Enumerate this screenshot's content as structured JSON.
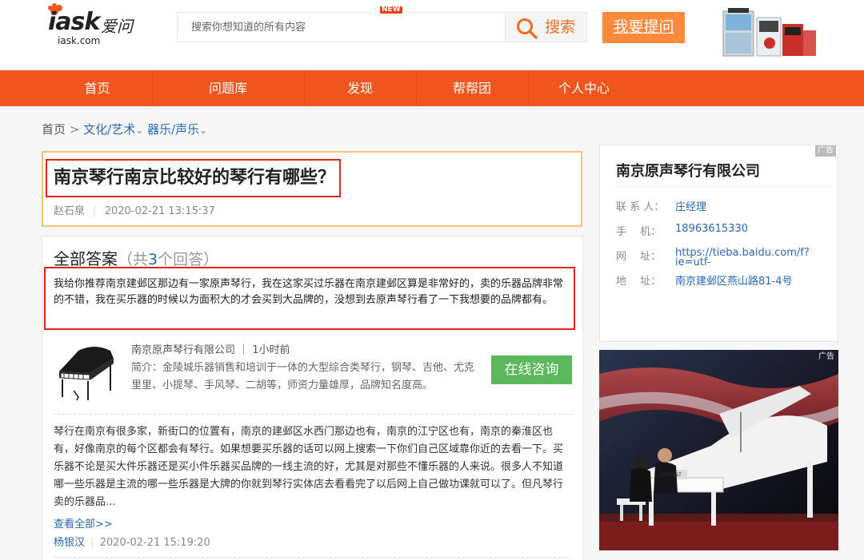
{
  "header": {
    "logo_text": "iask",
    "logo_cn": "爱问",
    "logo_domain": "iask.com",
    "search_placeholder": "搜索你想知道的所有内容",
    "search_button": "搜索",
    "ask_button": "我要提问"
  },
  "nav": {
    "items": [
      "首页",
      "问题库",
      "发现",
      "帮帮团",
      "个人中心"
    ],
    "new_badge": "NEW"
  },
  "breadcrumb": {
    "home": "首页",
    "sep": ">",
    "cat1": "文化/艺术",
    "cat2": "器乐/声乐"
  },
  "question": {
    "title": "南京琴行南京比较好的琴行有哪些？",
    "author": "赵石泉",
    "datetime": "2020-02-21 13:15:37"
  },
  "answers": {
    "heading": "全部答案",
    "count_prefix": "（共",
    "count": "3",
    "count_suffix": "个回答）",
    "first": "我给你推荐南京建邺区那边有一家原声琴行，我在这家买过乐器在南京建邺区算是非常好的，卖的乐器品牌非常的不错，我在买乐器的时候以为面积大的才会买到大品牌的，没想到去原声琴行看了一下我想要的品牌都有。",
    "company_line": "南京原声琴行有限公司 ｜ 1小时前",
    "company_intro": "简介：金陵城乐器销售和培训于一体的大型综合类琴行，钢琴、吉他、尤克里里、小提琴、手风琴、二胡等，师资力量雄厚，品牌知名度高。",
    "consult_button": "在线咨询",
    "second": "琴行在南京有很多家，新街口的位置有，南京的建邺区水西门那边也有，南京的江宁区也有，南京的秦淮区也有，好像南京的每个区都会有琴行。如果想要买乐器的话可以网上搜索一下你们自己区域靠你近的去看一下。买乐器不论是买大件乐器还是买小件乐器买品牌的一线主流的好，尤其是对那些不懂乐器的人来说。很多人不知道哪一些乐器是主流的哪一些乐器是大牌的你就到琴行实体店去看看完了以后网上自己做功课就可以了。但凡琴行卖的乐器品...",
    "view_all": "查看全部>>",
    "second_author": "杨银汉",
    "second_datetime": "2020-02-21 15:19:20"
  },
  "side_card": {
    "ad_label": "广告",
    "title": "南京原声琴行有限公司",
    "contact_label": "联 系 人：",
    "contact": "庄经理",
    "phone_label": "手　 机：",
    "phone": "18963615330",
    "site_label": "网　 址：",
    "site": "https://tieba.baidu.com/f?ie=utf-",
    "addr_label": "地　 址：",
    "addr": "南京建邺区燕山路81-4号"
  },
  "side_photo": {
    "ad_label": "广告",
    "piano_brand": "SCHOLLT"
  },
  "colors": {
    "brand_orange": "#f0561d",
    "ask_orange": "#ff8a3d",
    "link_blue": "#2a67b4",
    "highlight_red": "#e0251f",
    "consult_green": "#5cb85c"
  }
}
